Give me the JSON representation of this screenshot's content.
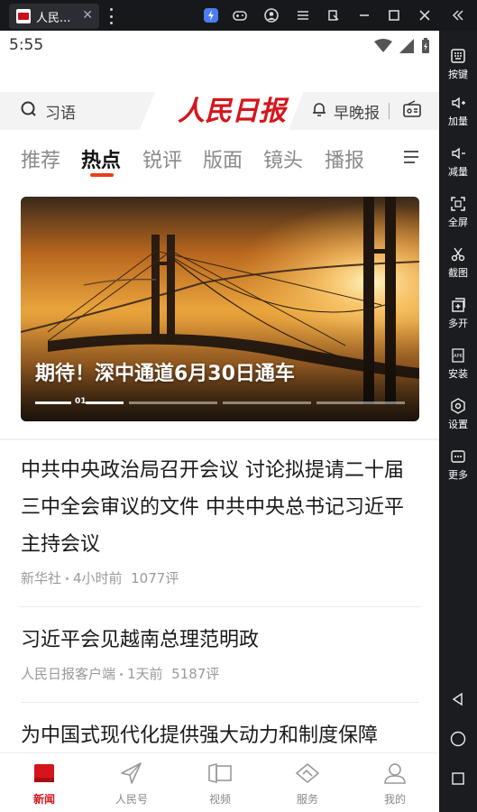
{
  "window": {
    "tab_title": "人民...",
    "close_glyph": "✕"
  },
  "toolbar_icons": [
    "bolt-icon",
    "gamepad-icon",
    "account-icon",
    "menu-icon",
    "screen-rotate-icon",
    "minimize-icon",
    "maximize-icon",
    "close-icon",
    "collapse-icon"
  ],
  "sidebar": {
    "items": [
      {
        "label": "按键",
        "icon": "keyboard-icon"
      },
      {
        "label": "加量",
        "icon": "volume-up-icon"
      },
      {
        "label": "减量",
        "icon": "volume-down-icon"
      },
      {
        "label": "全屏",
        "icon": "fullscreen-icon"
      },
      {
        "label": "截图",
        "icon": "scissors-icon"
      },
      {
        "label": "多开",
        "icon": "multi-instance-icon"
      },
      {
        "label": "安装",
        "icon": "apk-install-icon"
      },
      {
        "label": "设置",
        "icon": "settings-icon"
      },
      {
        "label": "更多",
        "icon": "more-icon"
      }
    ]
  },
  "status": {
    "time": "5:55"
  },
  "header": {
    "search_placeholder": "习语",
    "logo_text": "人民日报",
    "morning_label": "早晚报"
  },
  "channels": [
    {
      "label": "推荐",
      "active": false
    },
    {
      "label": "热点",
      "active": true
    },
    {
      "label": "锐评",
      "active": false
    },
    {
      "label": "版面",
      "active": false
    },
    {
      "label": "镜头",
      "active": false
    },
    {
      "label": "播报",
      "active": false
    }
  ],
  "banner": {
    "caption": "期待！深中通道6月30日通车",
    "index": "01"
  },
  "news": [
    {
      "title": "中共中央政治局召开会议 讨论拟提请二十届三中全会审议的文件 中共中央总书记习近平主持会议",
      "source": "新华社",
      "time": "4小时前",
      "comments": "1077评"
    },
    {
      "title": "习近平会见越南总理范明政",
      "source": "人民日报客户端",
      "time": "1天前",
      "comments": "5187评"
    },
    {
      "title": "为中国式现代化提供强大动力和制度保障",
      "source": "",
      "time": "",
      "comments": ""
    }
  ],
  "bottom_nav": [
    {
      "label": "新闻",
      "icon": "newspaper-icon",
      "active": true
    },
    {
      "label": "人民号",
      "icon": "send-icon",
      "active": false
    },
    {
      "label": "视频",
      "icon": "video-icon",
      "active": false
    },
    {
      "label": "服务",
      "icon": "service-icon",
      "active": false
    },
    {
      "label": "我的",
      "icon": "profile-icon",
      "active": false
    }
  ],
  "colors": {
    "brand_red": "#d5151b",
    "accent_orange": "#e8401c"
  }
}
